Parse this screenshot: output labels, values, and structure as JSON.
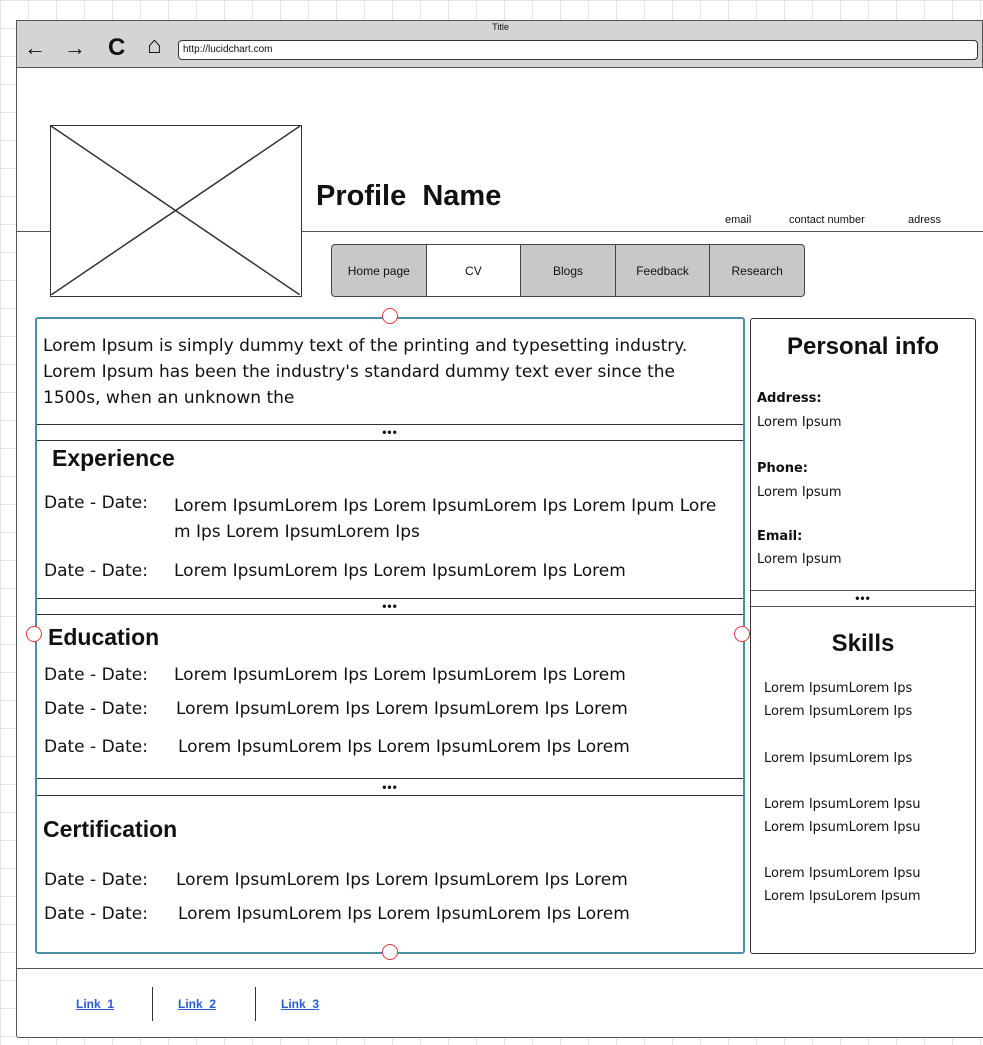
{
  "window": {
    "title": "Title",
    "url": "http://lucidchart.com"
  },
  "nav": {
    "back": "←",
    "forward": "→",
    "refresh": "C",
    "home": "⌂"
  },
  "header": {
    "profile_name": "Profile  Name",
    "contact": [
      "email",
      "contact number",
      "adress"
    ]
  },
  "tabs": [
    "Home page",
    "CV",
    "Blogs",
    "Feedback",
    "Research"
  ],
  "intro": "Lorem Ipsum is simply dummy text of the printing and typesetting industry. Lorem Ipsum has been the industry's standard dummy text ever since the 1500s, when an unknown the",
  "dots": "•••",
  "experience": {
    "heading": "Experience",
    "rows": [
      {
        "date": "Date - Date:",
        "text": "Lorem IpsumLorem Ips Lorem IpsumLorem Ips Lorem Ipum Lorem Ips Lorem IpsumLorem Ips"
      },
      {
        "date": "Date - Date:",
        "text": "Lorem IpsumLorem Ips Lorem IpsumLorem Ips Lorem"
      }
    ]
  },
  "education": {
    "heading": "Education",
    "rows": [
      {
        "date": "Date - Date:",
        "text": "Lorem IpsumLorem Ips Lorem IpsumLorem Ips Lorem"
      },
      {
        "date": "Date - Date:",
        "text": "Lorem IpsumLorem Ips Lorem IpsumLorem Ips Lorem"
      },
      {
        "date": "Date - Date:",
        "text": "Lorem IpsumLorem Ips Lorem IpsumLorem Ips Lorem"
      }
    ]
  },
  "certification": {
    "heading": "Certification",
    "rows": [
      {
        "date": "Date - Date:",
        "text": "Lorem IpsumLorem Ips Lorem IpsumLorem Ips Lorem"
      },
      {
        "date": "Date - Date:",
        "text": "Lorem IpsumLorem Ips Lorem IpsumLorem Ips Lorem"
      }
    ]
  },
  "personal_info": {
    "title": "Personal info",
    "fields": [
      {
        "label": "Address:",
        "value": "Lorem Ipsum"
      },
      {
        "label": "Phone:",
        "value": "Lorem Ipsum"
      },
      {
        "label": "Email:",
        "value": "Lorem Ipsum"
      }
    ]
  },
  "skills": {
    "title": "Skills",
    "items": [
      "Lorem IpsumLorem Ips",
      "Lorem IpsumLorem Ips",
      "Lorem IpsumLorem Ips",
      "Lorem IpsumLorem Ipsu",
      "Lorem IpsumLorem Ipsu",
      "Lorem IpsumLorem Ipsu",
      "Lorem IpsuLorem Ipsum"
    ]
  },
  "footer": {
    "links": [
      "Link_1",
      "Link_2",
      "Link_3"
    ]
  },
  "colors": {
    "selection": "#4a90a4",
    "handle": "#e0393e",
    "link": "#2a5bd7",
    "tab_bg": "#c8c8c8"
  }
}
